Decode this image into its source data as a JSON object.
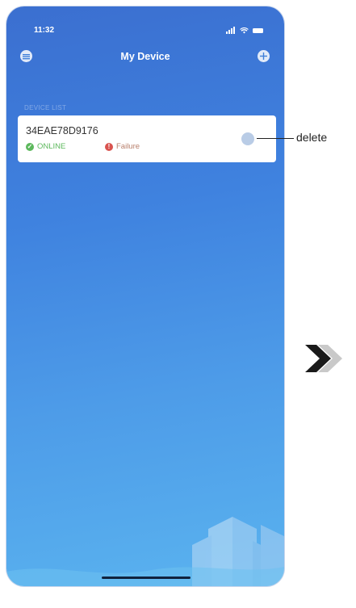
{
  "status_bar": {
    "time": "11:32"
  },
  "header": {
    "title": "My Device"
  },
  "section": {
    "label": "DEVICE LIST"
  },
  "device": {
    "id": "34EAE78D9176",
    "online_label": "ONLINE",
    "failure_label": "Failure"
  },
  "annotation": {
    "delete_label": "delete"
  },
  "colors": {
    "background_top": "#3b6fd0",
    "background_bottom": "#5ab3ef",
    "online": "#5cb85c",
    "failure": "#d9534f"
  }
}
